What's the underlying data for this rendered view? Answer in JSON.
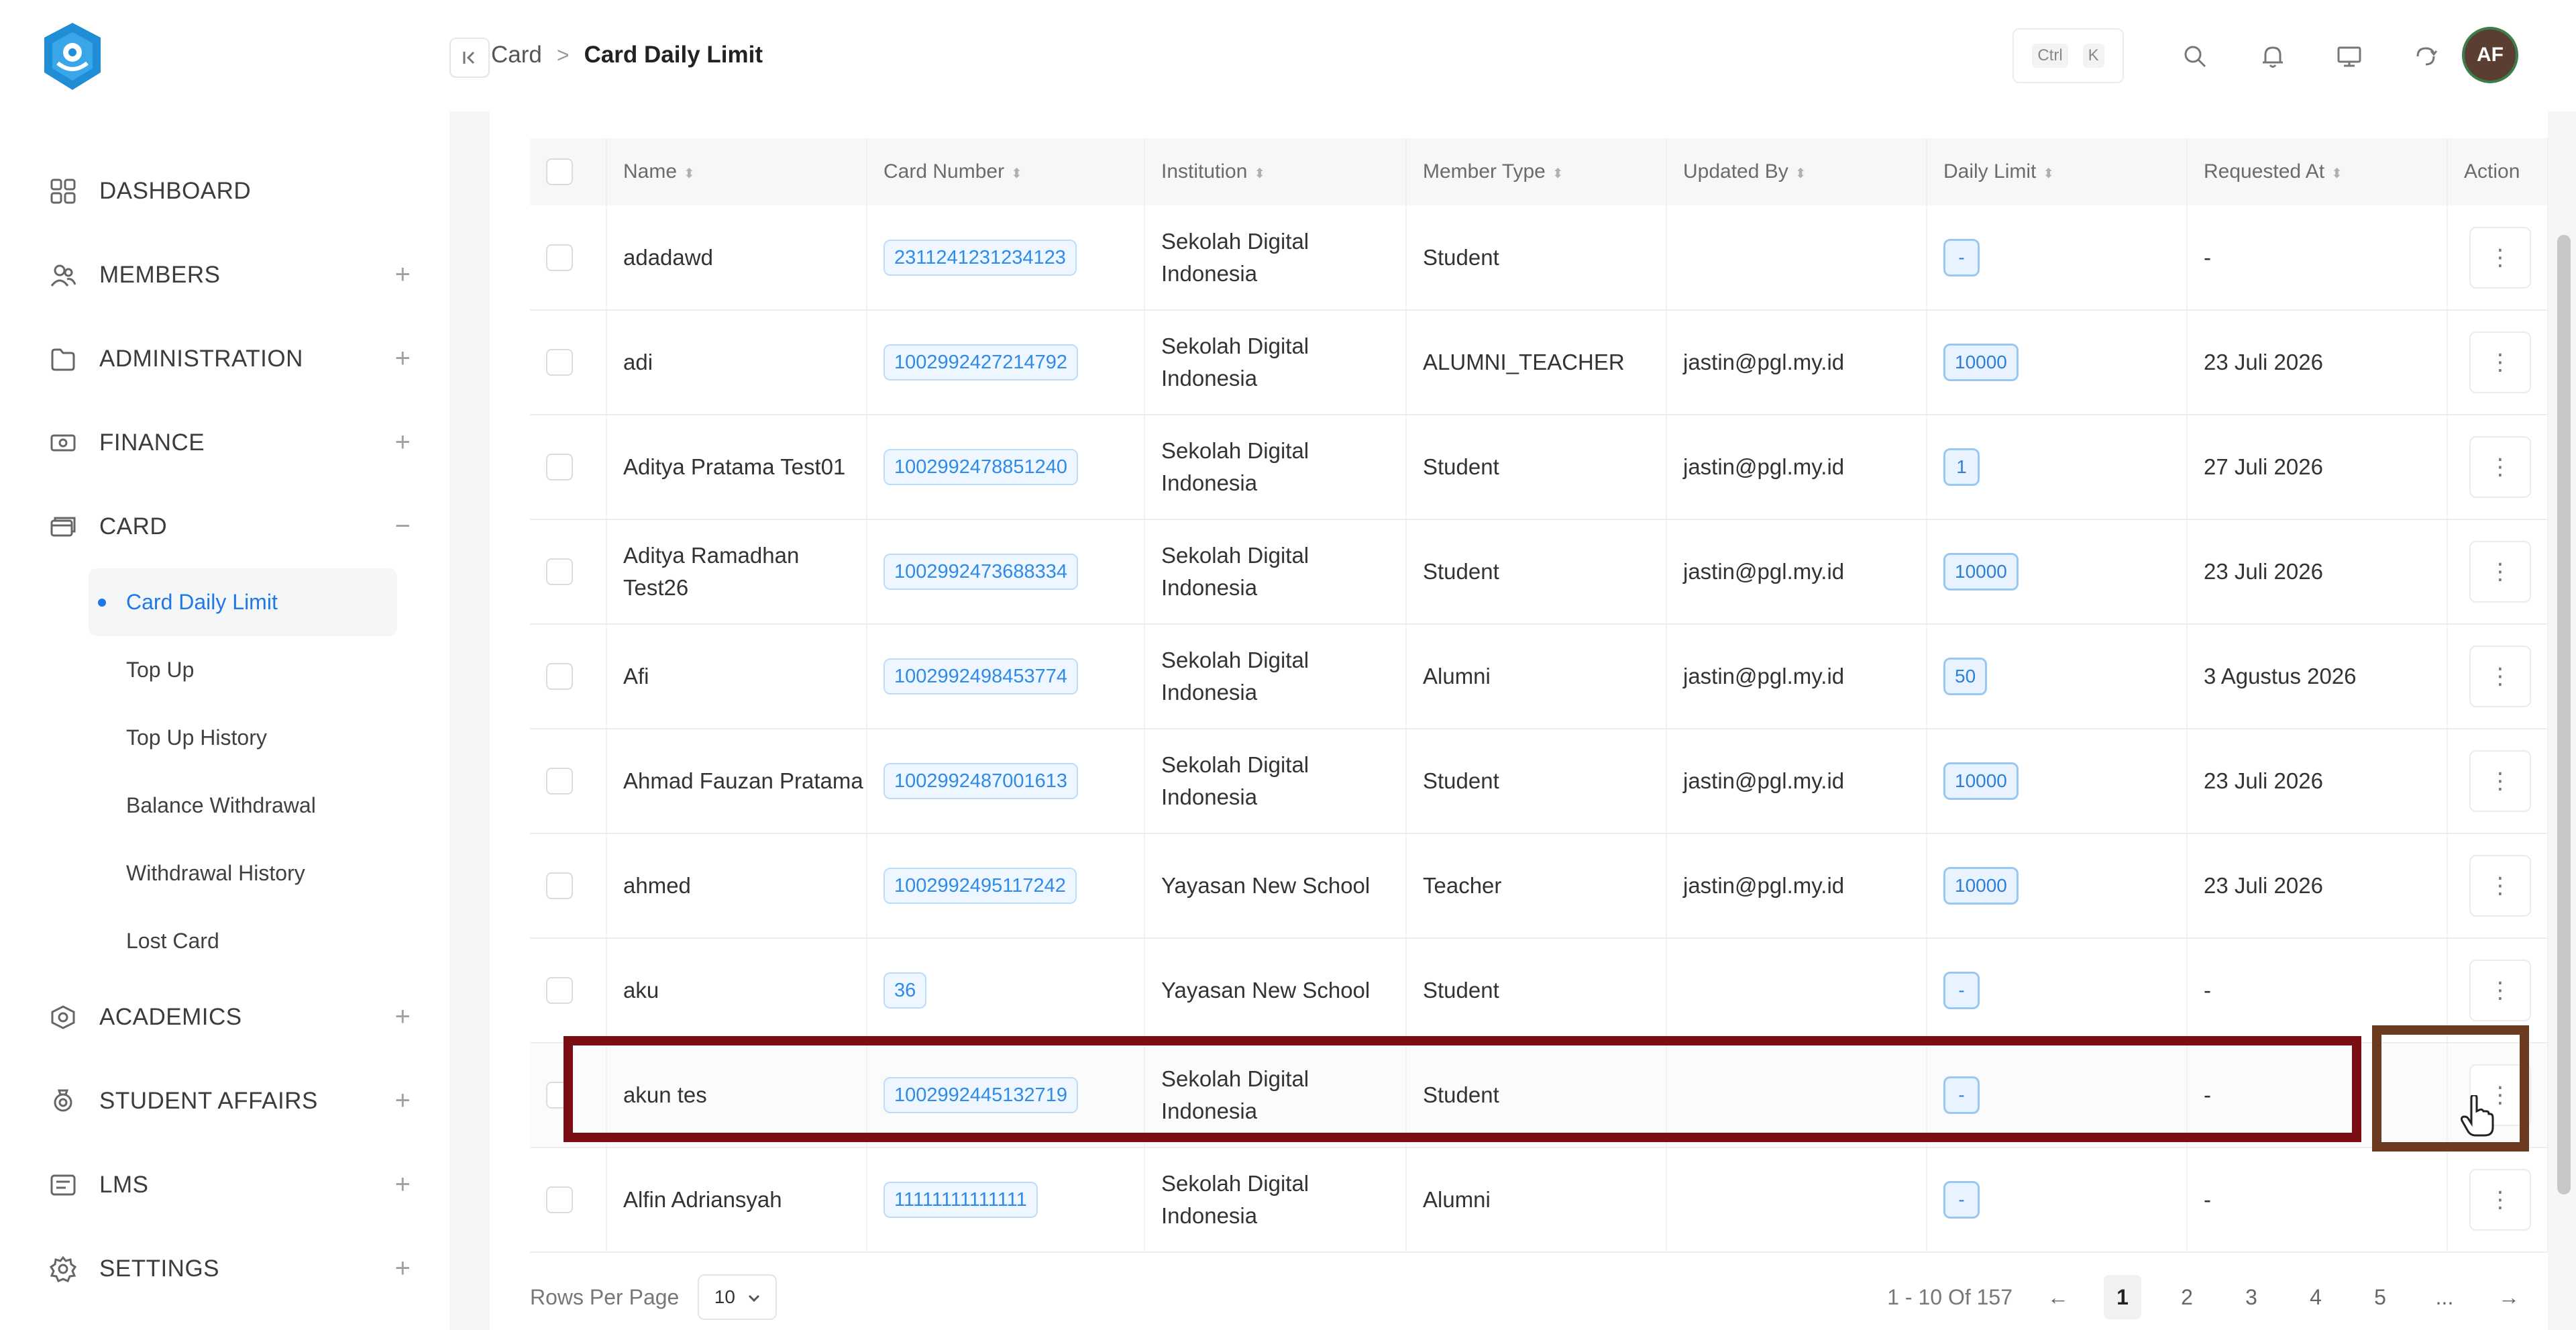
{
  "sidebar": {
    "items": [
      {
        "label": "DASHBOARD",
        "icon": "dashboard-grid-icon",
        "expand": ""
      },
      {
        "label": "MEMBERS",
        "icon": "users-icon",
        "expand": "+"
      },
      {
        "label": "ADMINISTRATION",
        "icon": "folder-icon",
        "expand": "+"
      },
      {
        "label": "FINANCE",
        "icon": "money-icon",
        "expand": "+"
      },
      {
        "label": "CARD",
        "icon": "card-icon",
        "expand": "−"
      }
    ],
    "card_sub": [
      "Card Daily Limit",
      "Top Up",
      "Top Up History",
      "Balance Withdrawal",
      "Withdrawal History",
      "Lost Card"
    ],
    "items_after": [
      {
        "label": "ACADEMICS",
        "icon": "academics-icon",
        "expand": "+"
      },
      {
        "label": "STUDENT AFFAIRS",
        "icon": "trophy-icon",
        "expand": "+"
      },
      {
        "label": "LMS",
        "icon": "lms-icon",
        "expand": "+"
      },
      {
        "label": "SETTINGS",
        "icon": "gear-icon",
        "expand": "+"
      }
    ]
  },
  "topbar": {
    "breadcrumb_parent": "Card",
    "breadcrumb_sep": ">",
    "breadcrumb_current": "Card Daily Limit",
    "kbd_ctrl": "Ctrl",
    "kbd_k": "K",
    "avatar": "AF"
  },
  "table": {
    "headers": [
      "Name",
      "Card Number",
      "Institution",
      "Member Type",
      "Updated By",
      "Daily Limit",
      "Requested At",
      "Action"
    ],
    "rows": [
      {
        "name": "adadawd",
        "card": "2311241231234123",
        "inst": "Sekolah Digital Indonesia",
        "type": "Student",
        "updated": "",
        "limit": "-",
        "requested": "-"
      },
      {
        "name": "adi",
        "card": "1002992427214792",
        "inst": "Sekolah Digital Indonesia",
        "type": "ALUMNI_TEACHER",
        "updated": "jastin@pgl.my.id",
        "limit": "10000",
        "requested": "23 Juli 2026"
      },
      {
        "name": "Aditya Pratama Test01",
        "card": "1002992478851240",
        "inst": "Sekolah Digital Indonesia",
        "type": "Student",
        "updated": "jastin@pgl.my.id",
        "limit": "1",
        "requested": "27 Juli 2026"
      },
      {
        "name": "Aditya Ramadhan Test26",
        "card": "1002992473688334",
        "inst": "Sekolah Digital Indonesia",
        "type": "Student",
        "updated": "jastin@pgl.my.id",
        "limit": "10000",
        "requested": "23 Juli 2026"
      },
      {
        "name": "Afi",
        "card": "1002992498453774",
        "inst": "Sekolah Digital Indonesia",
        "type": "Alumni",
        "updated": "jastin@pgl.my.id",
        "limit": "50",
        "requested": "3 Agustus 2026"
      },
      {
        "name": "Ahmad Fauzan Pratama",
        "card": "1002992487001613",
        "inst": "Sekolah Digital Indonesia",
        "type": "Student",
        "updated": "jastin@pgl.my.id",
        "limit": "10000",
        "requested": "23 Juli 2026"
      },
      {
        "name": "ahmed",
        "card": "1002992495117242",
        "inst": "Yayasan New School",
        "type": "Teacher",
        "updated": "jastin@pgl.my.id",
        "limit": "10000",
        "requested": "23 Juli 2026"
      },
      {
        "name": "aku",
        "card": "36",
        "inst": "Yayasan New School",
        "type": "Student",
        "updated": "",
        "limit": "-",
        "requested": "-"
      },
      {
        "name": "akun tes",
        "card": "1002992445132719",
        "inst": "Sekolah Digital Indonesia",
        "type": "Student",
        "updated": "",
        "limit": "-",
        "requested": "-"
      },
      {
        "name": "Alfin Adriansyah",
        "card": "11111111111111",
        "inst": "Sekolah Digital Indonesia",
        "type": "Alumni",
        "updated": "",
        "limit": "-",
        "requested": "-"
      }
    ],
    "action_glyph": "⋮"
  },
  "footer": {
    "rows_per_page_label": "Rows Per Page",
    "rows_per_page_value": "10",
    "range": "1 - 10 Of 157",
    "prev": "←",
    "pages": [
      "1",
      "2",
      "3",
      "4",
      "5"
    ],
    "ellipsis": "...",
    "next": "→",
    "current_page": "1"
  },
  "colors": {
    "accent": "#1e78e8",
    "highlight_row": "#7b0d15",
    "highlight_action": "#6b3a1f",
    "avatar_bg": "#5a3e31"
  }
}
